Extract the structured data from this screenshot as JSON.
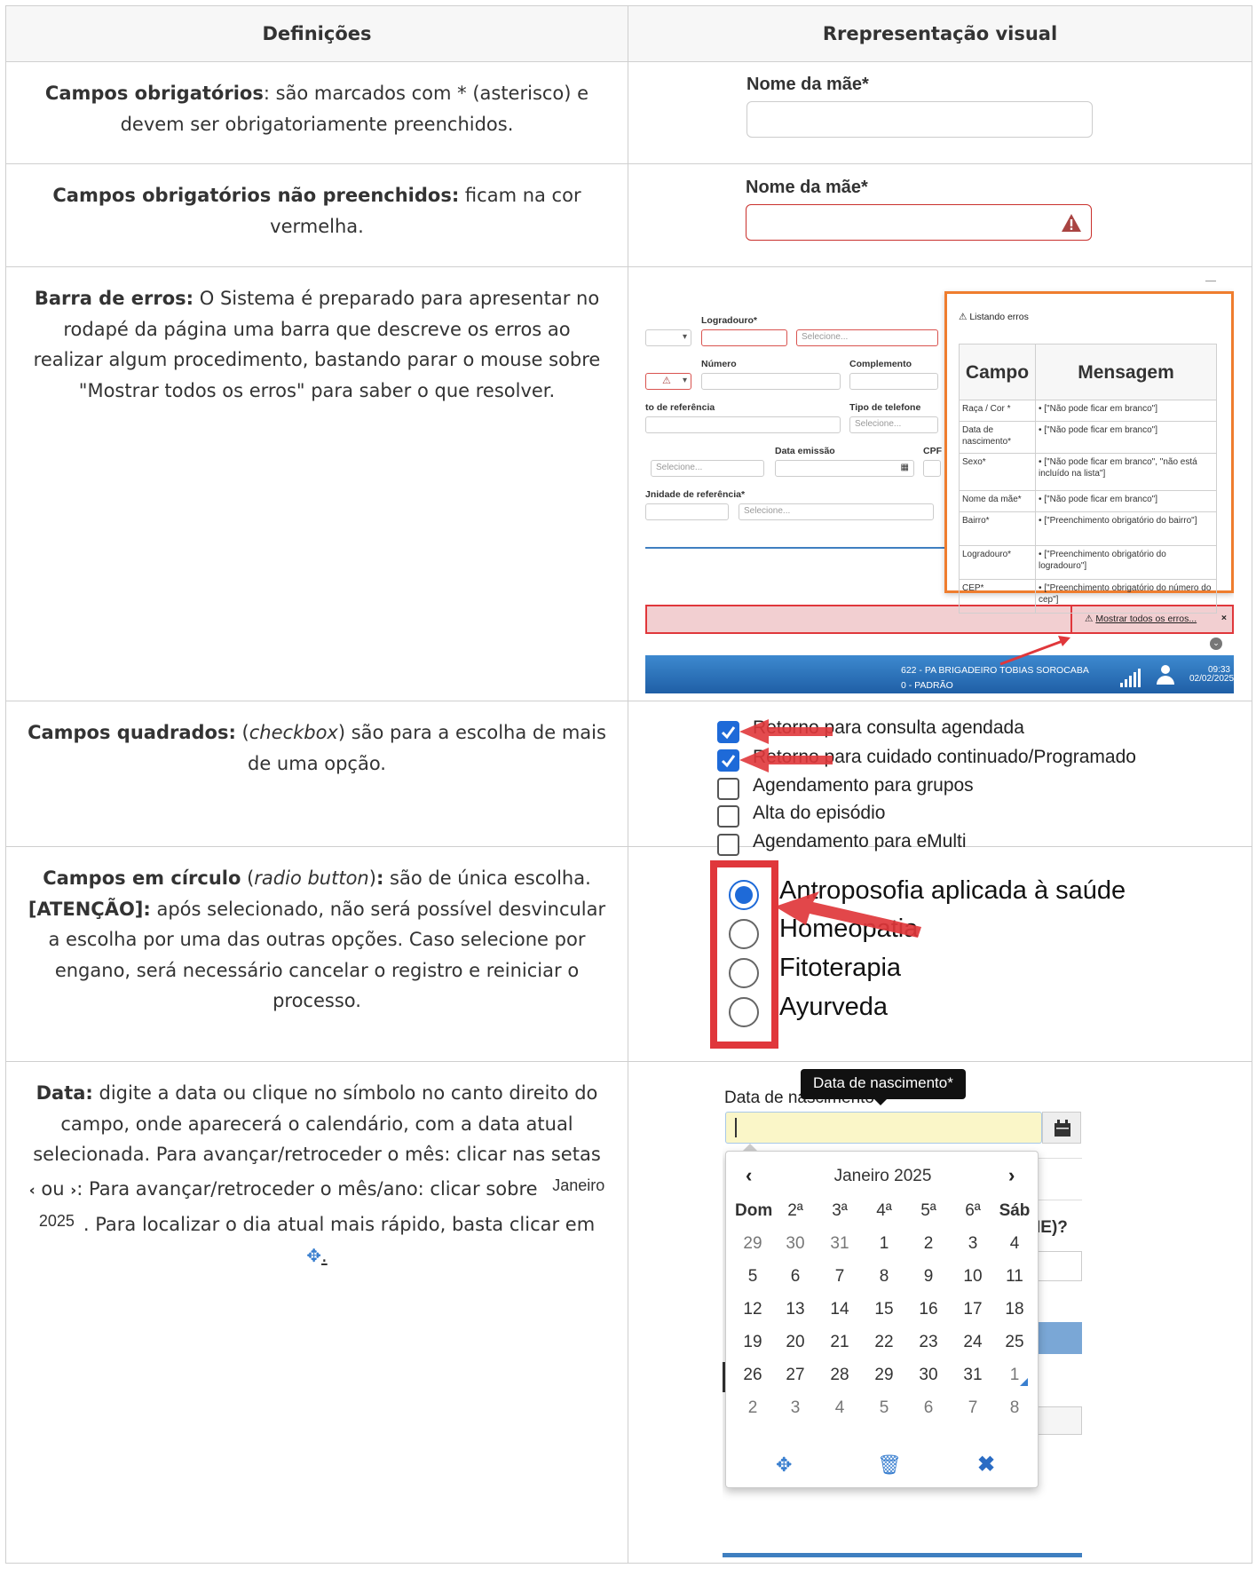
{
  "table": {
    "header_def": "Definições",
    "header_vis": "Rrepresentação visual"
  },
  "rows": {
    "r1": {
      "def_bold": "Campos obrigatórios",
      "def_text": ": são marcados com * (asterisco) e devem ser obrigatoriamente preenchidos.",
      "label": "Nome da mãe*"
    },
    "r2": {
      "def_bold": "Campos obrigatórios não preenchidos:",
      "def_text": " ficam na cor vermelha.",
      "label": "Nome da mãe*"
    },
    "r3": {
      "def_bold": "Barra de erros:",
      "def_text": " O Sistema é preparado para apresentar no rodapé da página uma barra que descreve os erros ao realizar algum procedimento, bastando parar o mouse sobre \"Mostrar todos os erros\" para saber o que resolver.",
      "form": {
        "logradouro": "Logradouro*",
        "selecione": "Selecione...",
        "numero": "Número",
        "complemento": "Complemento",
        "ponto_ref": "to de referência",
        "tipo_tel": "Tipo de telefone",
        "data_emissao": "Data emissão",
        "cpf": "CPF",
        "unidade_ref": "Jnidade de referência*"
      },
      "errors_title": "Listando erros",
      "errors_header": [
        "Campo",
        "Mensagem"
      ],
      "errors": [
        {
          "campo": "Raça / Cor *",
          "msg": "[\"Não pode ficar em branco\"]"
        },
        {
          "campo": "Data de nascimento*",
          "msg": "[\"Não pode ficar em branco\"]"
        },
        {
          "campo": "Sexo*",
          "msg": "[\"Não pode ficar em branco\", \"não está incluído na lista\"]"
        },
        {
          "campo": "Nome da mãe*",
          "msg": "[\"Não pode ficar em branco\"]"
        },
        {
          "campo": "Bairro*",
          "msg": "[\"Preenchimento obrigatório do bairro\"]"
        },
        {
          "campo": "Logradouro*",
          "msg": "[\"Preenchimento obrigatório do logradouro\"]"
        },
        {
          "campo": "CEP*",
          "msg": "[\"Preenchimento obrigatório do número do cep\"]"
        }
      ],
      "show_all_errors": "Mostrar todos os erros...",
      "status_unit": "622 - PA BRIGADEIRO TOBIAS SOROCABA",
      "status_profile": "0 - PADRÃO",
      "status_time": "09:33",
      "status_date": "02/02/2025"
    },
    "r4": {
      "def_bold": "Campos quadrados:",
      "def_open": " (",
      "def_italic": "checkbox",
      "def_text": ") são para a escolha de mais de uma opção.",
      "options": [
        {
          "label": "Retorno para consulta agendada",
          "checked": true
        },
        {
          "label": "Retorno para cuidado continuado/Programado",
          "checked": true
        },
        {
          "label": "Agendamento para grupos",
          "checked": false
        },
        {
          "label": "Alta do episódio",
          "checked": false
        },
        {
          "label": "Agendamento para eMulti",
          "checked": false
        }
      ]
    },
    "r5": {
      "def_bold": "Campos em círculo",
      "def_open": " (",
      "def_italic": "radio button",
      "def_close": ")",
      "def_colon": ":",
      "def_text1": " são de única escolha.",
      "def_bold2": "[ATENÇÃO]:",
      "def_text2": " após selecionado, não será possível desvincular a escolha por uma das outras opções. Caso selecione por engano, será necessário cancelar o registro e reiniciar o processo.",
      "options": [
        {
          "label": "Antroposofia aplicada à saúde",
          "selected": true
        },
        {
          "label": "Homeopatia",
          "selected": false
        },
        {
          "label": "Fitoterapia",
          "selected": false
        },
        {
          "label": "Ayurveda",
          "selected": false
        }
      ]
    },
    "r6": {
      "def_bold": "Data:",
      "def_text1": " digite a data ou clique no símbolo no canto direito do campo, onde aparecerá o calendário, com a data atual selecionada. Para avançar/retroceder o mês: clicar nas setas ",
      "def_ou": " ou ",
      "def_text2": ": Para avançar/retroceder o mês/ano: clicar sobre ",
      "def_month_img": "Janeiro 2025",
      "def_text3": ". Para localizar o dia atual mais rápido, basta clicar em ",
      "def_end": ".",
      "tooltip": "Data de nascimento*",
      "label": "Data de nascimento*",
      "side_text": "IE)?",
      "cal_title": "Janeiro 2025",
      "weekdays": [
        "Dom",
        "2ª",
        "3ª",
        "4ª",
        "5ª",
        "6ª",
        "Sáb"
      ],
      "weeks": [
        [
          "29",
          "30",
          "31",
          "1",
          "2",
          "3",
          "4"
        ],
        [
          "5",
          "6",
          "7",
          "8",
          "9",
          "10",
          "11"
        ],
        [
          "12",
          "13",
          "14",
          "15",
          "16",
          "17",
          "18"
        ],
        [
          "19",
          "20",
          "21",
          "22",
          "23",
          "24",
          "25"
        ],
        [
          "26",
          "27",
          "28",
          "29",
          "30",
          "31",
          "1"
        ],
        [
          "2",
          "3",
          "4",
          "5",
          "6",
          "7",
          "8"
        ]
      ]
    }
  },
  "colors": {
    "accent_red": "#e0373b",
    "orange": "#ef7d2e",
    "blue": "#1e6ad8",
    "status_bar": "#2b78c2"
  }
}
